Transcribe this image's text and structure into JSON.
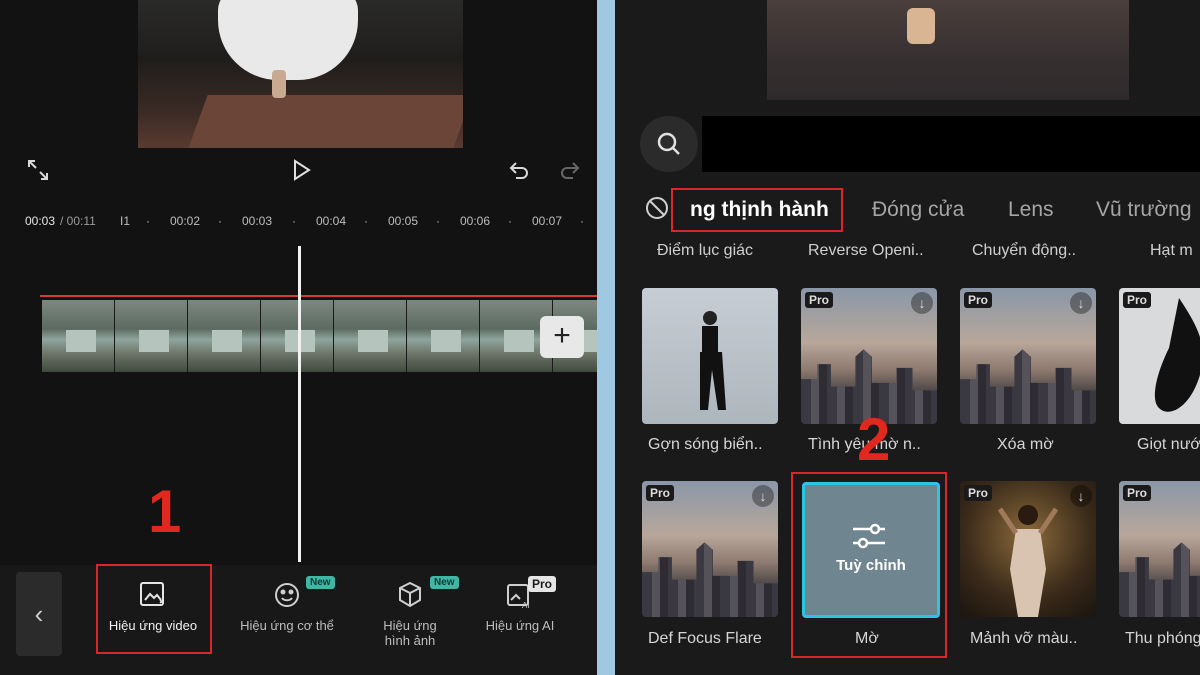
{
  "left_panel": {
    "timeline": {
      "current_time": "00:03",
      "total_time": " / 00:11",
      "marks": [
        "I1",
        "00:02",
        "00:03",
        "00:04",
        "00:05",
        "00:06",
        "00:07"
      ]
    },
    "step_label": "1",
    "tools": [
      {
        "label": "Hiệu ứng video",
        "icon": "image-sparkle-icon",
        "badge": ""
      },
      {
        "label": "Hiệu ứng cơ thể",
        "icon": "face-icon",
        "badge": "New"
      },
      {
        "label": "Hiệu ứng hình ảnh",
        "icon": "cube-icon",
        "badge": "New"
      },
      {
        "label": "Hiệu ứng AI",
        "icon": "ai-image-icon",
        "badge": "Pro"
      }
    ]
  },
  "right_panel": {
    "tabs": [
      "ng thịnh hành",
      "Đóng cửa",
      "Lens",
      "Vũ trường"
    ],
    "categories": [
      "Điểm lục giác",
      "Reverse Openi..",
      "Chuyển động..",
      "Hạt m"
    ],
    "step_label": "2",
    "effects_row1": [
      {
        "label": "Gợn sóng biển..",
        "pro": ""
      },
      {
        "label": "Tình yêu mờ n..",
        "pro": "Pro"
      },
      {
        "label": "Xóa mờ",
        "pro": "Pro"
      },
      {
        "label": "Giọt nước",
        "pro": "Pro"
      }
    ],
    "effects_row2": [
      {
        "label": "Def Focus Flare",
        "pro": "Pro"
      },
      {
        "label": "Mờ",
        "pro": "",
        "overlay": "Tuỳ chỉnh"
      },
      {
        "label": "Mảnh vỡ màu..",
        "pro": "Pro"
      },
      {
        "label": "Thu phóng",
        "pro": "Pro"
      }
    ]
  },
  "colors": {
    "highlight": "#d8262b",
    "selected": "#28c6e0"
  }
}
